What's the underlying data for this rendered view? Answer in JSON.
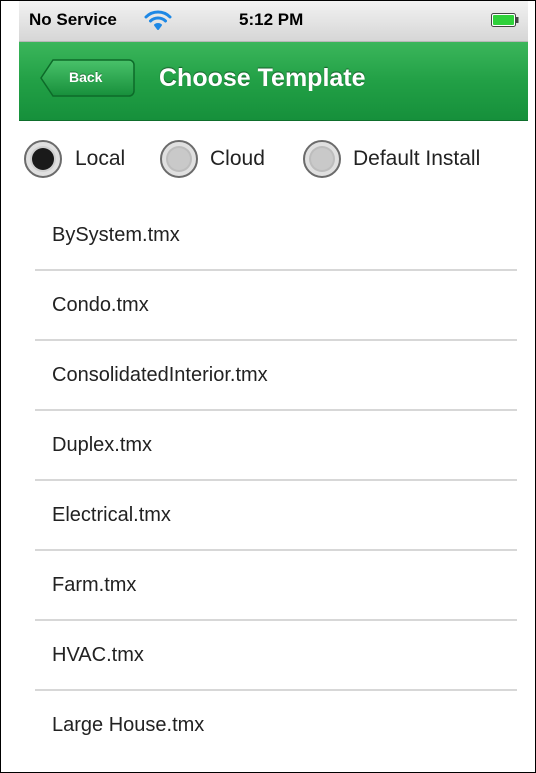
{
  "status_bar": {
    "carrier": "No Service",
    "time": "5:12 PM",
    "wifi_icon": "wifi-icon",
    "battery_icon": "battery-icon",
    "battery_color": "#2fd13b"
  },
  "nav": {
    "back_label": "Back",
    "title": "Choose Template",
    "bar_color": "#22a046"
  },
  "source_options": [
    {
      "label": "Local",
      "selected": true
    },
    {
      "label": "Cloud",
      "selected": false
    },
    {
      "label": "Default Install",
      "selected": false
    }
  ],
  "templates": [
    {
      "label": "BySystem.tmx"
    },
    {
      "label": "Condo.tmx"
    },
    {
      "label": "ConsolidatedInterior.tmx"
    },
    {
      "label": "Duplex.tmx"
    },
    {
      "label": "Electrical.tmx"
    },
    {
      "label": "Farm.tmx"
    },
    {
      "label": "HVAC.tmx"
    },
    {
      "label": "Large House.tmx"
    }
  ]
}
